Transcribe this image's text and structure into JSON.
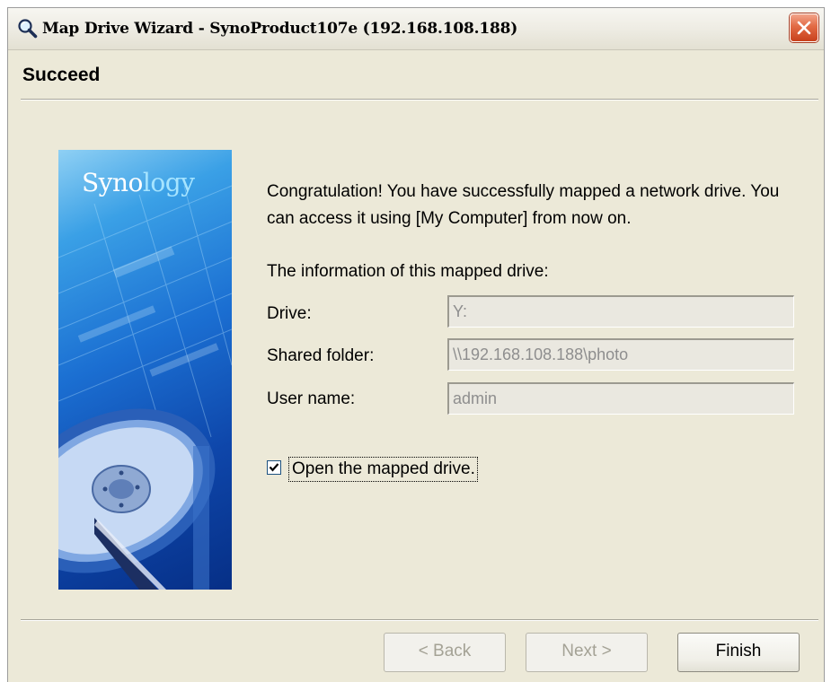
{
  "window": {
    "title": "Map Drive Wizard - SynoProduct107e (192.168.108.188)"
  },
  "page": {
    "title": "Succeed"
  },
  "banner": {
    "brand_prefix": "Syno",
    "brand_suffix": "logy"
  },
  "message": "Congratulation! You have successfully mapped a network drive. You can access it using [My Computer] from now on.",
  "info": {
    "title": "The information of this mapped drive:",
    "fields": [
      {
        "label": "Drive:",
        "value": "Y:"
      },
      {
        "label": "Shared folder:",
        "value": "\\\\192.168.108.188\\photo"
      },
      {
        "label": "User name:",
        "value": "admin"
      }
    ]
  },
  "option": {
    "label": "Open the mapped drive.",
    "checked": true
  },
  "buttons": {
    "back": "< Back",
    "next": "Next >",
    "finish": "Finish"
  },
  "icons": {
    "title": "magnifier-icon",
    "close": "close-icon",
    "check": "checkmark-icon"
  },
  "colors": {
    "dialog_bg": "#ece9d8",
    "close_button": "#e26a44",
    "banner_blue": "#1b6fd2"
  }
}
